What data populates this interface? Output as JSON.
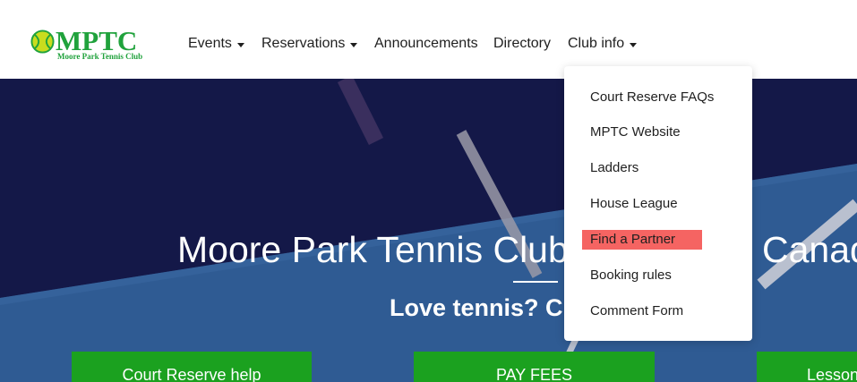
{
  "logo": {
    "text": "MPTC",
    "subtitle": "Moore Park Tennis Club"
  },
  "nav": {
    "items": [
      {
        "label": "Events",
        "has_dropdown": true
      },
      {
        "label": "Reservations",
        "has_dropdown": true
      },
      {
        "label": "Announcements",
        "has_dropdown": false
      },
      {
        "label": "Directory",
        "has_dropdown": false
      },
      {
        "label": "Club info",
        "has_dropdown": true
      }
    ]
  },
  "club_info_menu": {
    "items": [
      {
        "label": "Court Reserve FAQs"
      },
      {
        "label": "MPTC Website"
      },
      {
        "label": "Ladders"
      },
      {
        "label": "House League"
      },
      {
        "label": "Find a Partner",
        "highlighted": true
      },
      {
        "label": "Booking rules"
      },
      {
        "label": "Comment Form"
      }
    ],
    "highlight_color": "#f56462"
  },
  "hero": {
    "title_left": "Moore Park Tennis Club",
    "title_right": "Canad",
    "subtitle": "Love tennis? C",
    "buttons": [
      {
        "label": "Court Reserve help"
      },
      {
        "label": "PAY FEES"
      },
      {
        "label": "Lesson"
      }
    ]
  },
  "colors": {
    "brand_green": "#20a23c",
    "hero_navy": "#141848",
    "hero_blue": "#2f5b93",
    "button_green": "#1ba11f"
  }
}
